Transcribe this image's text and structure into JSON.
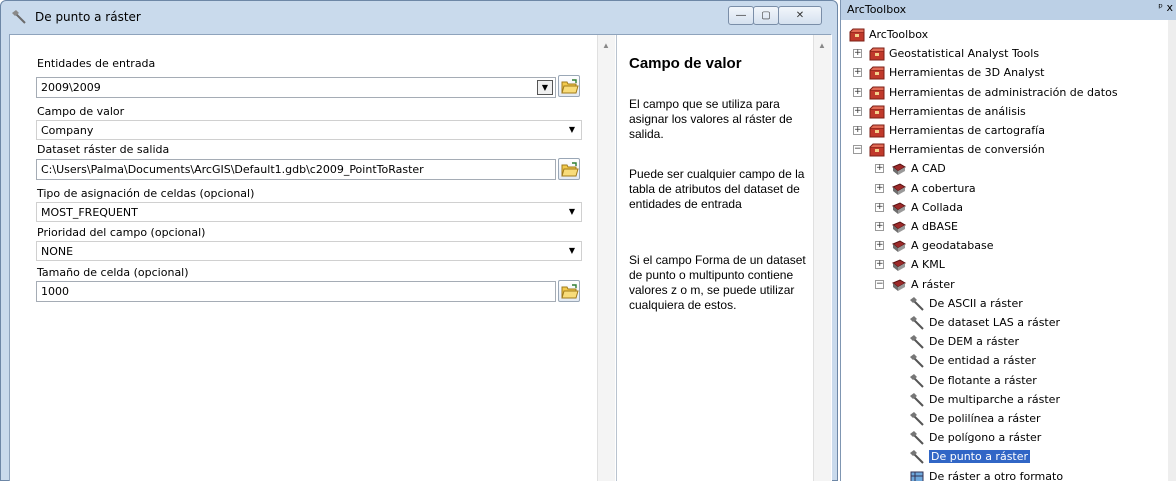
{
  "dialog": {
    "title": "De punto a ráster",
    "controls": {
      "minimize": "—",
      "maximize": "▢",
      "close": "✕"
    }
  },
  "params": {
    "input_features": {
      "label": "Entidades de entrada",
      "value": "2009\\2009"
    },
    "value_field": {
      "label": "Campo de valor",
      "value": "Company"
    },
    "output_raster": {
      "label": "Dataset ráster de salida",
      "value": "C:\\Users\\Palma\\Documents\\ArcGIS\\Default1.gdb\\c2009_PointToRaster"
    },
    "cell_assignment": {
      "label": "Tipo de asignación de celdas (opcional)",
      "value": "MOST_FREQUENT"
    },
    "priority_field": {
      "label": "Prioridad del campo (opcional)",
      "value": "NONE"
    },
    "cell_size": {
      "label": "Tamaño de celda (opcional)",
      "value": "1000"
    }
  },
  "help": {
    "title": "Campo de valor",
    "p1": "El campo que se utiliza para asignar los valores al ráster de salida.",
    "p2": "Puede ser cualquier campo de la tabla de atributos del dataset de entidades de entrada",
    "p3": "Si el campo Forma de un dataset de punto o multipunto contiene valores z o m, se puede utilizar cualquiera de estos."
  },
  "toolbox": {
    "header": "ArcToolbox",
    "pin": "ᵖ x",
    "root": "ArcToolbox",
    "top_level": [
      "Geostatistical Analyst Tools",
      "Herramientas de 3D Analyst",
      "Herramientas de administración de datos",
      "Herramientas de análisis",
      "Herramientas de cartografía",
      "Herramientas de conversión"
    ],
    "conversion_sets": [
      "A CAD",
      "A cobertura",
      "A Collada",
      "A dBASE",
      "A geodatabase",
      "A KML",
      "A ráster"
    ],
    "raster_tools": [
      "De ASCII a ráster",
      "De dataset LAS a ráster",
      "De DEM a ráster",
      "De entidad a ráster",
      "De flotante a ráster",
      "De multiparche a ráster",
      "De polilínea a ráster",
      "De polígono a ráster",
      "De punto a ráster",
      "De ráster a otro formato"
    ],
    "selected_tool": "De punto a ráster"
  },
  "colors": {
    "window_frame": "#c9daec",
    "toolbox_header": "#bcd0e6",
    "selection": "#3166c6",
    "toolbox_icon": "#c0392b"
  }
}
